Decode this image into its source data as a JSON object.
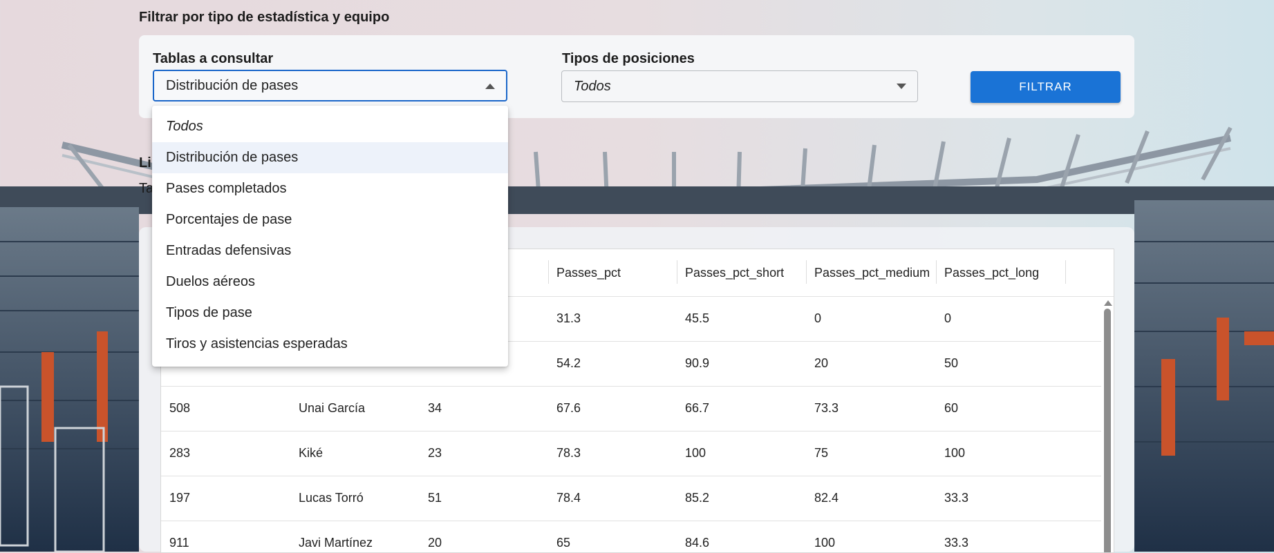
{
  "filter_section": {
    "title": "Filtrar por tipo de estadística y equipo",
    "tables_label": "Tablas a consultar",
    "tables_value": "Distribución de pases",
    "positions_label": "Tipos de posiciones",
    "positions_value": "Todos",
    "filter_button": "FILTRAR"
  },
  "dropdown": {
    "options": [
      "Todos",
      "Distribución de pases",
      "Pases completados",
      "Porcentajes de pase",
      "Entradas defensivas",
      "Duelos aéreos",
      "Tipos de pase",
      "Tiros y asistencias esperadas"
    ],
    "selected_index": 1
  },
  "partial_texts": {
    "heading_fragment": "Li",
    "sub_fragment": "Ta"
  },
  "table": {
    "columns": [
      "Passes_pct",
      "Passes_pct_short",
      "Passes_pct_medium",
      "Passes_pct_long"
    ],
    "rows": [
      [
        "",
        "",
        "",
        "31.3",
        "45.5",
        "0",
        "0"
      ],
      [
        "",
        "",
        "",
        "54.2",
        "90.9",
        "20",
        "50"
      ],
      [
        "508",
        "Unai García",
        "34",
        "67.6",
        "66.7",
        "73.3",
        "60"
      ],
      [
        "283",
        "Kiké",
        "23",
        "78.3",
        "100",
        "75",
        "100"
      ],
      [
        "197",
        "Lucas Torró",
        "51",
        "78.4",
        "85.2",
        "82.4",
        "33.3"
      ],
      [
        "911",
        "Javi Martínez",
        "20",
        "65",
        "84.6",
        "100",
        "33.3"
      ]
    ]
  },
  "colors": {
    "accent": "#1a73d6",
    "focus_border": "#1a66c9",
    "selected_option_bg": "#edf2fa"
  }
}
